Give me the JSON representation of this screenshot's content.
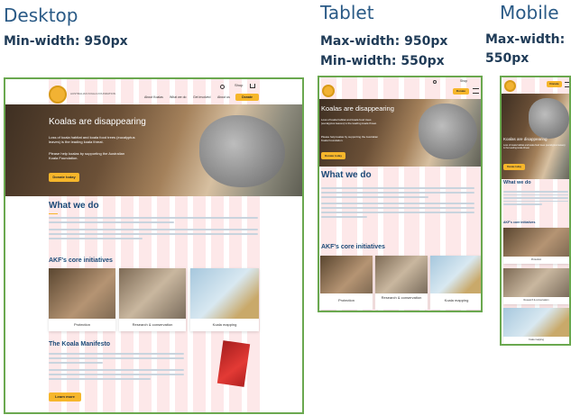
{
  "headings": {
    "desktop": {
      "title": "Desktop",
      "rule1": "Min-width: 950px"
    },
    "tablet": {
      "title": "Tablet",
      "rule1": "Max-width: 950px",
      "rule2": "Min-width: 550px"
    },
    "mobile": {
      "title": "Mobile",
      "rule1": "Max-width:",
      "rule2": "550px"
    }
  },
  "site": {
    "org_name": "AUSTRALIAN KOALA FOUNDATION",
    "nav": [
      "About Koalas",
      "What we do",
      "Get involved",
      "About us"
    ],
    "donate": "Donate",
    "shop": "Shop",
    "hero_title": "Koalas are disappearing",
    "hero_text": "Loss of koala habitat and koala food trees (eucalyptus leaves) is the leading koala threat.",
    "hero_text2": "Please help koalas by supporting the Australian Koala Foundation.",
    "hero_button": "Donate today",
    "what_title": "What we do",
    "initiatives_title": "AKF's core initiatives",
    "cards": [
      "Protection",
      "Research & conservation",
      "Koala mapping"
    ],
    "manifesto_title": "The Koala Manifesto",
    "manifesto_button": "Learn more"
  },
  "colors": {
    "accent": "#f6b62b",
    "frame": "#6aa84f",
    "heading": "#1b4a78"
  }
}
